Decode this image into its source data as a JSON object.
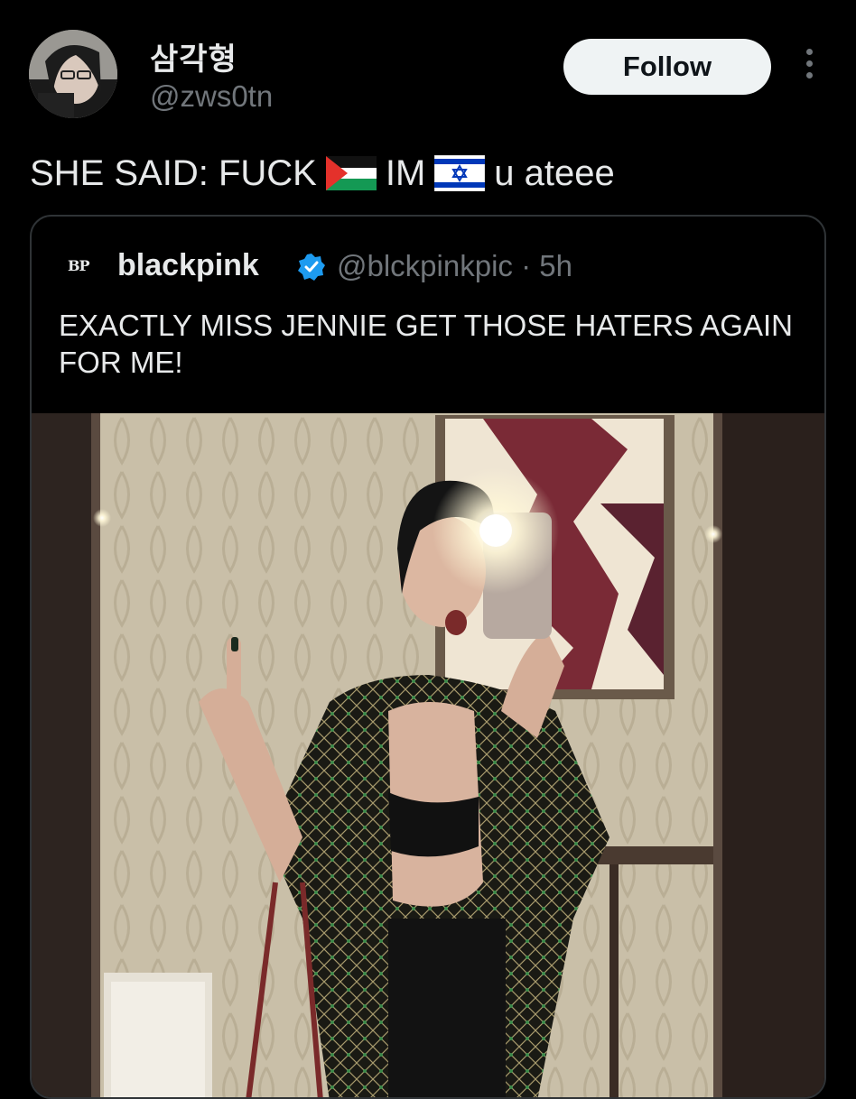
{
  "author": {
    "display_name": "삼각형",
    "handle": "@zws0tn",
    "avatar_icon": "avatar-photo"
  },
  "actions": {
    "follow_label": "Follow",
    "more_icon": "more-vertical-icon"
  },
  "tweet": {
    "text_part1": "SHE SAID: FUCK",
    "flag1_icon": "palestine-flag-icon",
    "text_part2": "IM",
    "flag2_icon": "israel-flag-icon",
    "text_part3": "u ateee"
  },
  "quoted": {
    "logo_text": "BP",
    "name": "blackpink",
    "verified_icon": "verified-badge-icon",
    "handle_time": "@blckpinkpic · 5h",
    "text": "EXACTLY MISS JENNIE GET THOSE HATERS AGAIN FOR ME!",
    "image_icon": "mirror-selfie-photo"
  },
  "colors": {
    "background": "#000000",
    "text": "#e7e9ea",
    "secondary": "#71767b",
    "border": "#2f3336",
    "verified": "#1d9bf0"
  }
}
